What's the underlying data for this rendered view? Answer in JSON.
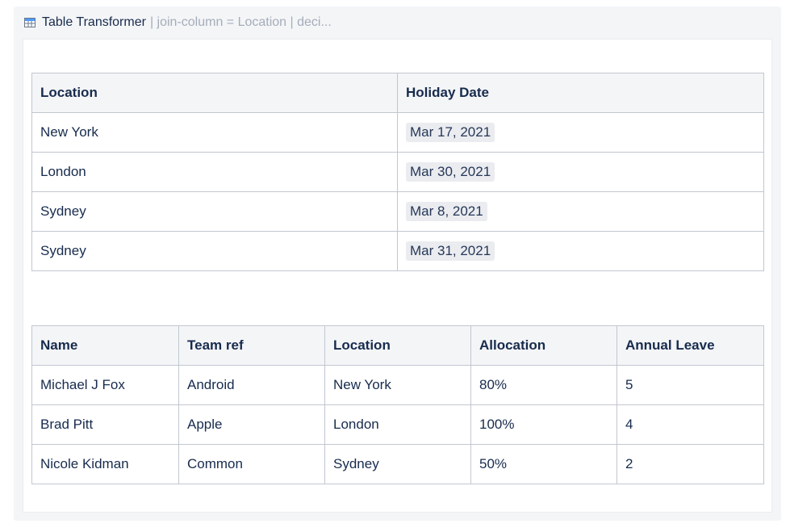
{
  "macro": {
    "icon": "table-transformer-icon",
    "title": "Table Transformer",
    "params": "| join-column = Location | deci..."
  },
  "holiday_table": {
    "headers": [
      "Location",
      "Holiday Date"
    ],
    "rows": [
      [
        "New York",
        "Mar 17, 2021"
      ],
      [
        "London",
        "Mar 30, 2021"
      ],
      [
        "Sydney",
        "Mar 8, 2021"
      ],
      [
        "Sydney",
        "Mar 31, 2021"
      ]
    ]
  },
  "staff_table": {
    "headers": [
      "Name",
      "Team ref",
      "Location",
      "Allocation",
      "Annual Leave"
    ],
    "rows": [
      [
        "Michael J Fox",
        "Android",
        "New York",
        "80%",
        "5"
      ],
      [
        "Brad Pitt",
        "Apple",
        "London",
        "100%",
        "4"
      ],
      [
        "Nicole Kidman",
        "Common",
        "Sydney",
        "50%",
        "2"
      ]
    ]
  },
  "colors": {
    "header_bg": "#f4f5f7",
    "border": "#c1c7d0",
    "lozenge_bg": "#ebecf0",
    "muted_text": "#a5adba",
    "text": "#172b4d"
  }
}
